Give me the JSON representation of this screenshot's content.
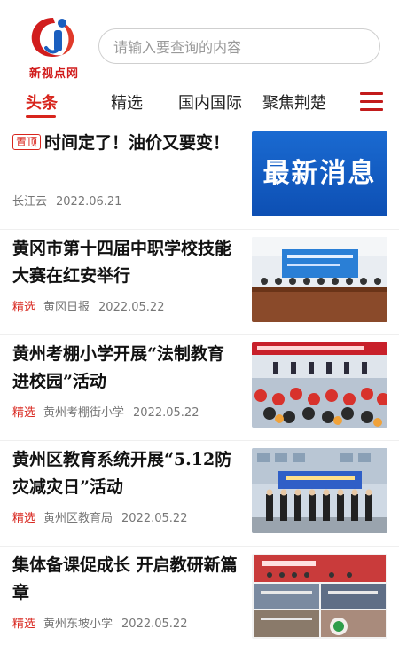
{
  "header": {
    "logo_text": "新视点网",
    "search_placeholder": "请输入要查询的内容"
  },
  "tabs": [
    {
      "label": "头条",
      "active": true
    },
    {
      "label": "精选",
      "active": false
    },
    {
      "label": "国内国际",
      "active": false
    },
    {
      "label": "聚焦荆楚",
      "active": false
    }
  ],
  "menu_icon": "hamburger-menu-icon",
  "accent_color": "#d8251d",
  "news": [
    {
      "pin": "置顶",
      "title": "时间定了！油价又要变！",
      "tag": "",
      "source": "长江云",
      "date": "2022.06.21",
      "thumb_text": "最新消息"
    },
    {
      "pin": "",
      "title": "黄冈市第十四届中职学校技能大赛在红安举行",
      "tag": "精选",
      "source": "黄冈日报",
      "date": "2022.05.22"
    },
    {
      "pin": "",
      "title": "黄州考棚小学开展“法制教育进校园”活动",
      "tag": "精选",
      "source": "黄州考棚街小学",
      "date": "2022.05.22"
    },
    {
      "pin": "",
      "title": "黄州区教育系统开展“5.12防灾减灾日”活动",
      "tag": "精选",
      "source": "黄州区教育局",
      "date": "2022.05.22"
    },
    {
      "pin": "",
      "title": "集体备课促成长 开启教研新篇章",
      "tag": "精选",
      "source": "黄州东坡小学",
      "date": "2022.05.22"
    }
  ]
}
